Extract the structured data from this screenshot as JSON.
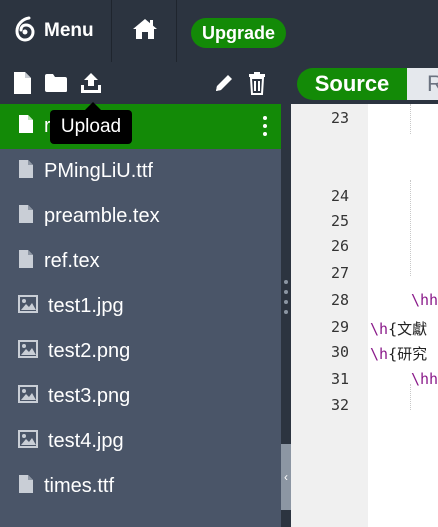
{
  "topbar": {
    "menu_label": "Menu",
    "upgrade_label": "Upgrade",
    "logo_icon": "overleaf-leaf-icon",
    "home_icon": "home-icon"
  },
  "toolbar": {
    "icons": [
      "new-file-icon",
      "new-folder-icon",
      "upload-icon",
      "rename-pencil-icon",
      "delete-trash-icon"
    ],
    "source_label": "Source",
    "rich_label": "R"
  },
  "tooltip": {
    "text": "Upload"
  },
  "files": [
    {
      "name": "",
      "icon": "file-icon",
      "selected": true
    },
    {
      "name": "PMingLiU.ttf",
      "icon": "file-icon"
    },
    {
      "name": "preamble.tex",
      "icon": "file-icon"
    },
    {
      "name": "ref.tex",
      "icon": "file-icon"
    },
    {
      "name": "test1.jpg",
      "icon": "image-icon"
    },
    {
      "name": "test2.png",
      "icon": "image-icon"
    },
    {
      "name": "test3.png",
      "icon": "image-icon"
    },
    {
      "name": "test4.jpg",
      "icon": "image-icon"
    },
    {
      "name": "times.ttf",
      "icon": "file-icon"
    }
  ],
  "selected_file_prefix": "r",
  "line_numbers": [
    "23",
    "24",
    "25",
    "26",
    "27",
    "28",
    "29",
    "30",
    "31",
    "32"
  ],
  "code": {
    "line28": "\\hh",
    "line29_cmd": "\\h",
    "line29_text": "{文獻",
    "line30_cmd": "\\h",
    "line30_text": "{研究",
    "line31": "\\hh"
  },
  "colors": {
    "accent": "#138a07",
    "sidebar": "#4a5568",
    "topbar": "#2c3440",
    "keyword": "#8a1a8a"
  }
}
